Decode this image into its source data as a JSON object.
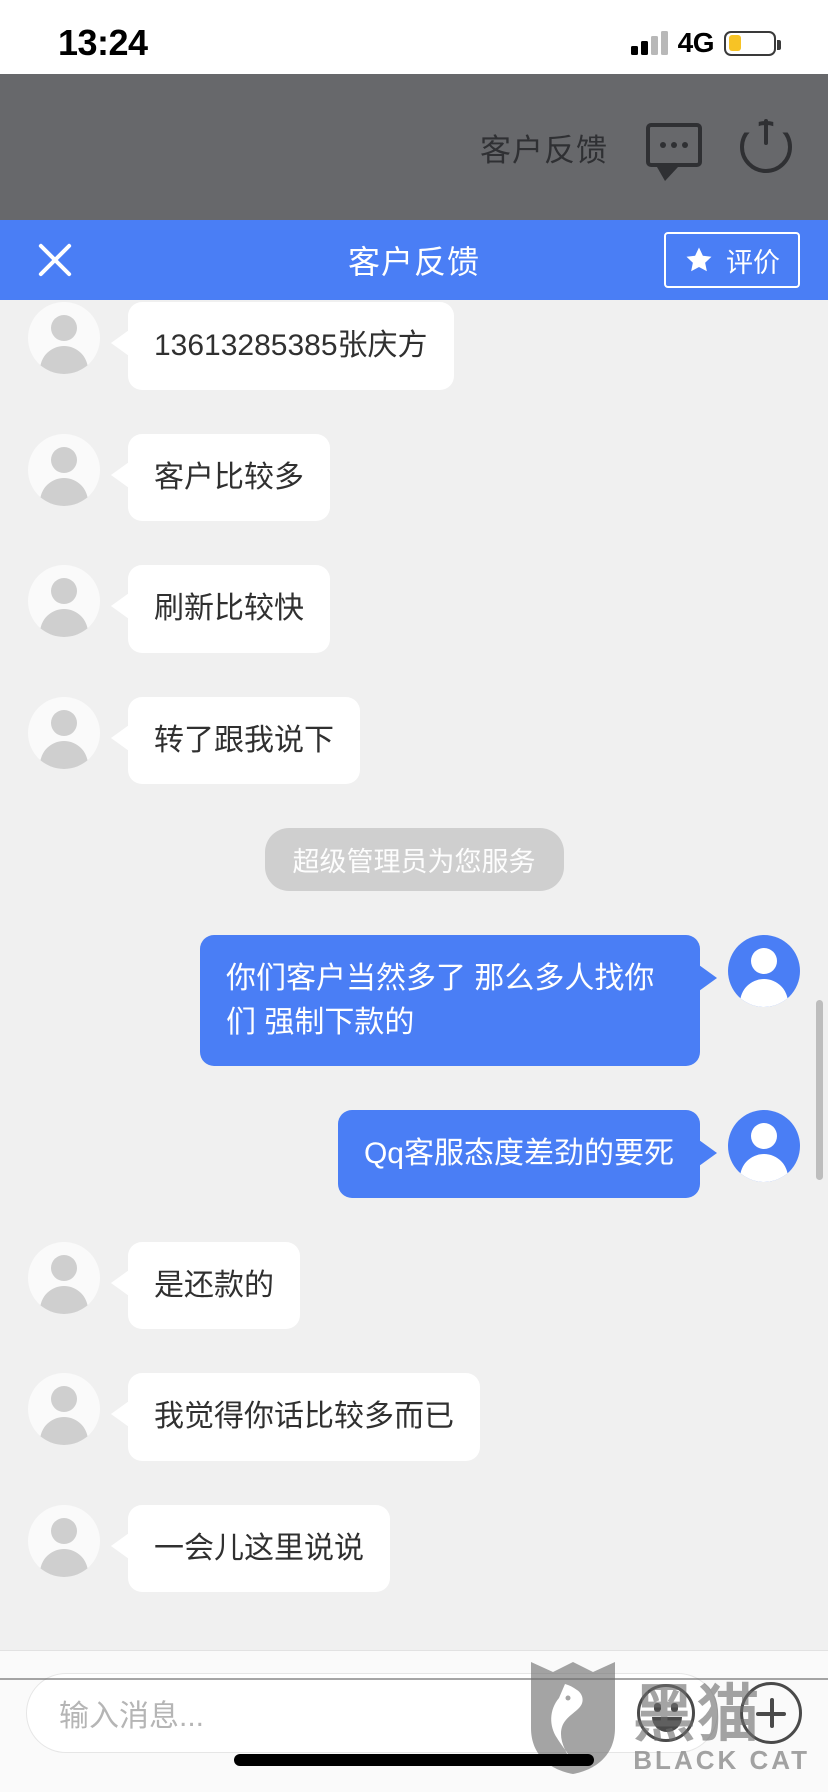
{
  "status_bar": {
    "time": "13:24",
    "network": "4G",
    "signal_bars_filled": 2,
    "signal_bars_total": 4,
    "battery_level_pct": 30,
    "battery_color": "#f7c325"
  },
  "app_header": {
    "title": "客户反馈",
    "background": "#67686b",
    "icons": [
      "chat-bubble-icon",
      "power-icon"
    ]
  },
  "nav_bar": {
    "title": "客户反馈",
    "close_label": "×",
    "rate_button_label": "评价",
    "background": "#4a7ef5"
  },
  "chat": {
    "messages": [
      {
        "side": "in",
        "text": "13613285385张庆方"
      },
      {
        "side": "in",
        "text": "客户比较多"
      },
      {
        "side": "in",
        "text": "刷新比较快"
      },
      {
        "side": "in",
        "text": "转了跟我说下"
      },
      {
        "side": "sys",
        "text": "超级管理员为您服务"
      },
      {
        "side": "out",
        "text": "你们客户当然多了 那么多人找你们 强制下款的"
      },
      {
        "side": "out",
        "text": "Qq客服态度差劲的要死"
      },
      {
        "side": "in",
        "text": "是还款的"
      },
      {
        "side": "in",
        "text": "我觉得你话比较多而已"
      },
      {
        "side": "in",
        "text": "一会儿这里说说"
      }
    ]
  },
  "input_bar": {
    "placeholder": "输入消息...",
    "emoji_button": "emoji-icon",
    "add_button": "plus-icon"
  },
  "watermark": {
    "cn": "黑猫",
    "en": "BLACK CAT"
  }
}
